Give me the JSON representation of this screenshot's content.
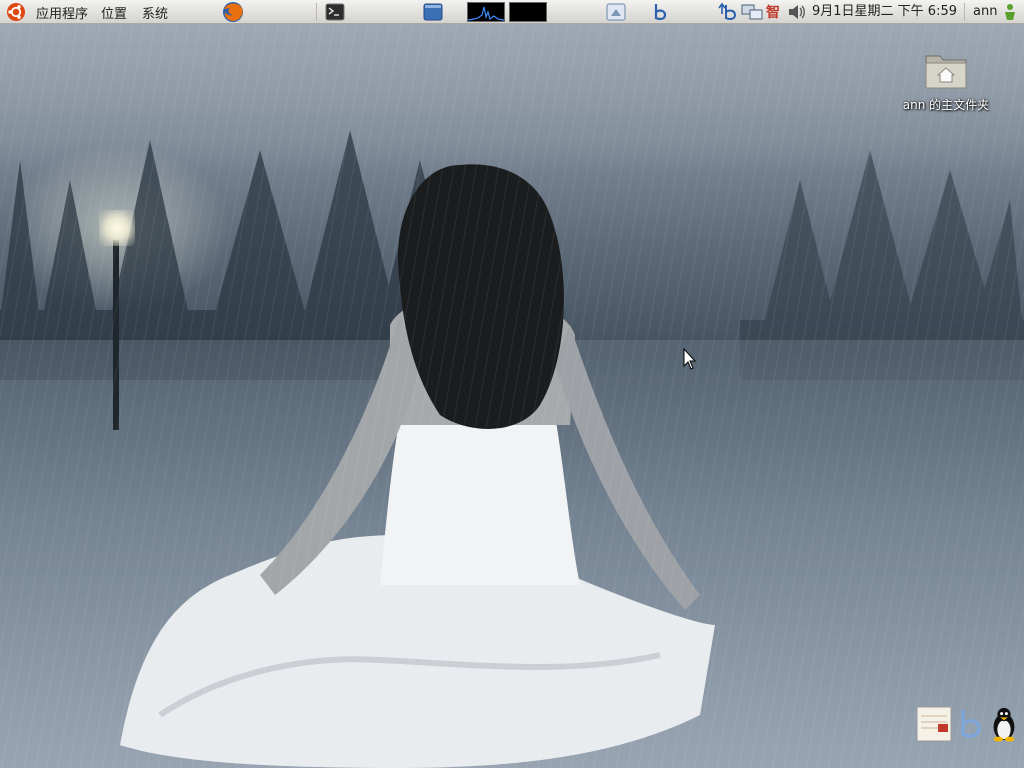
{
  "top_panel": {
    "menus": [
      {
        "label": "应用程序"
      },
      {
        "label": "位置"
      },
      {
        "label": "系统"
      }
    ],
    "launchers": [
      {
        "name": "firefox-icon"
      },
      {
        "name": "terminal-icon"
      },
      {
        "name": "window-icon"
      }
    ],
    "tray": {
      "ime_char": "智",
      "clock": "9月1日星期二 下午 6:59",
      "user": "ann"
    }
  },
  "desktop": {
    "icons": [
      {
        "label": "ann 的主文件夹",
        "icon": "home-folder-icon"
      }
    ],
    "bottom_right_icons": [
      "notepad-icon",
      "bluetooth-b-icon",
      "tux-penguin-icon"
    ]
  },
  "colors": {
    "panel_top": "#f3f3f1",
    "panel_bottom": "#d4d3cf",
    "desktop_tone": "#5d6a78"
  }
}
